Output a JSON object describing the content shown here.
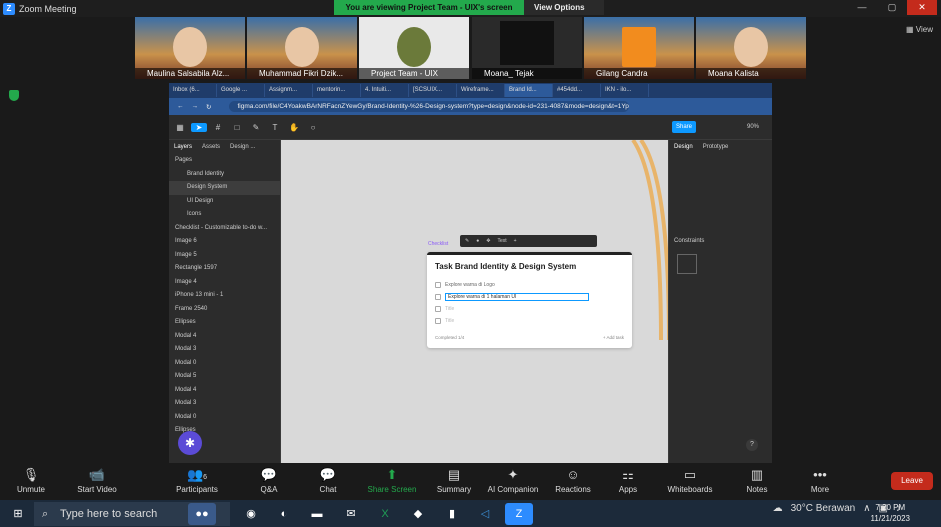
{
  "zoom": {
    "title": "Zoom Meeting",
    "banner": "You are viewing Project Team - UIX's screen",
    "view_options": "View Options",
    "view": "View",
    "participants": [
      {
        "name": "Maulina Salsabila Alz..."
      },
      {
        "name": "Muhammad Fikri Dzik..."
      },
      {
        "name": "Project Team - UIX"
      },
      {
        "name": "Moana_ Tejak"
      },
      {
        "name": "Gilang Candra"
      },
      {
        "name": "Moana Kalista"
      }
    ],
    "controls": [
      {
        "label": "Unmute",
        "icon": "mic-off-icon"
      },
      {
        "label": "Start Video",
        "icon": "video-off-icon"
      },
      {
        "label": "Participants",
        "icon": "people-icon",
        "count": "6"
      },
      {
        "label": "Q&A",
        "icon": "qa-icon"
      },
      {
        "label": "Chat",
        "icon": "chat-icon"
      },
      {
        "label": "Share Screen",
        "icon": "share-screen-icon"
      },
      {
        "label": "Summary",
        "icon": "summary-icon"
      },
      {
        "label": "AI Companion",
        "icon": "ai-companion-icon"
      },
      {
        "label": "Reactions",
        "icon": "reactions-icon"
      },
      {
        "label": "Apps",
        "icon": "apps-icon"
      },
      {
        "label": "Whiteboards",
        "icon": "whiteboard-icon"
      },
      {
        "label": "Notes",
        "icon": "notes-icon"
      },
      {
        "label": "More",
        "icon": "more-icon"
      }
    ],
    "leave": "Leave"
  },
  "browser": {
    "tabs": [
      "Inbox (6...",
      "Google ...",
      "Assignm...",
      "mentorin...",
      "4. Intuiti...",
      "[SCSUIX...",
      "Wireframe...",
      "Brand Id...",
      "#454dd...",
      "IKN - ilo..."
    ],
    "active_tab": 7,
    "url": "figma.com/file/C4YoakwBArNRFacnZYewGy/Brand-Identity-%26-Design-system?type=design&node-id=231-4087&mode=design&t=1YpTDFNoPa..."
  },
  "figma": {
    "share": "Share",
    "zoom": "90%",
    "layers_tabs": [
      "Layers",
      "Assets",
      "Design ..."
    ],
    "pages_label": "Pages",
    "pages": [
      "Brand Identity",
      "Design System",
      "UI Design",
      "Icons"
    ],
    "layers": [
      "Checklist - Customizable to-do w...",
      "Image 6",
      "Image 5",
      "Rectangle 1597",
      "Image 4",
      "iPhone 13 mini - 1",
      "Frame 2540",
      "Ellipses",
      "Modal 4",
      "Modal 3",
      "Modal 0",
      "Modal 5",
      "Modal 4",
      "Modal 3",
      "Modal 0",
      "Ellipses"
    ],
    "props_tabs": [
      "Design",
      "Prototype"
    ],
    "constraints": "Constraints",
    "float_toolbar_text": "Text",
    "checklist_label": "Checklist",
    "card": {
      "title": "Task Brand Identity & Design System",
      "items": [
        "Explore warna di Logo",
        "Explore warna di 1 halaman UI",
        "Title",
        "Title"
      ],
      "footer_left": "Completed 1/4",
      "footer_right": "+ Add task"
    }
  },
  "taskbar": {
    "search": "Type here to search",
    "weather": "30°C Berawan",
    "time": "7:20 PM",
    "date": "11/21/2023"
  }
}
